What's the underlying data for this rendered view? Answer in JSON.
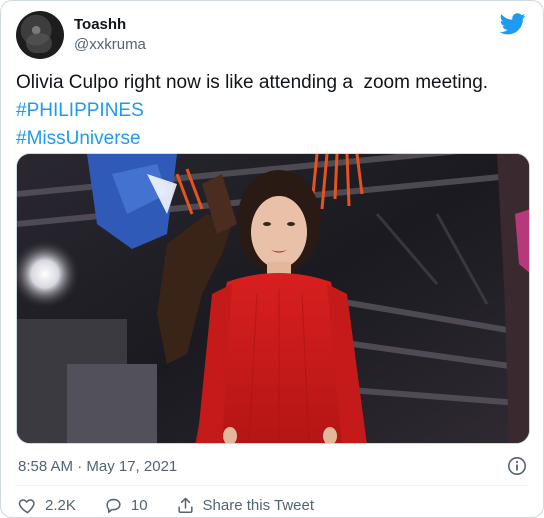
{
  "tweet": {
    "author": {
      "display_name": "Toashh",
      "handle": "@xxkruma"
    },
    "text_lines": [
      "Olivia Culpo right now is like attending a  zoom meeting.",
      "#PHILIPPINES",
      "#MissUniverse"
    ],
    "timestamp": "8:58 AM · May 17, 2021",
    "likes": "2.2K",
    "replies": "10",
    "share_label": "Share this Tweet"
  },
  "colors": {
    "hashtag": "#1d9bf0",
    "secondary_text": "#536471",
    "twitter_blue": "#1d9bf0",
    "dress_red": "#d31e1e"
  },
  "icons": {
    "brand": "twitter-bird-icon",
    "info": "info-icon",
    "like": "heart-icon",
    "reply": "reply-bubble-icon",
    "share": "share-icon"
  }
}
